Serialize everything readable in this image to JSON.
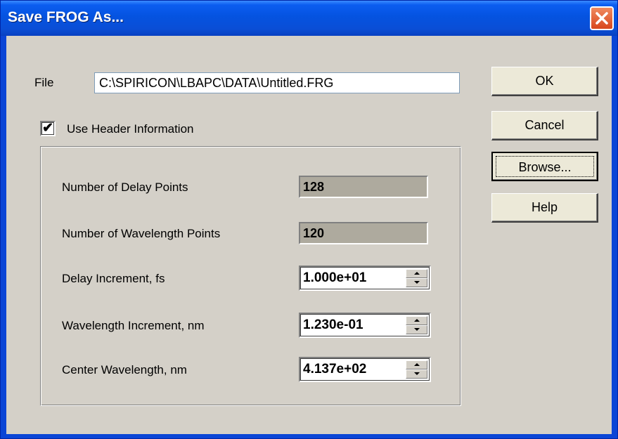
{
  "window": {
    "title": "Save FROG As..."
  },
  "file": {
    "label": "File",
    "value": "C:\\SPIRICON\\LBAPC\\DATA\\Untitled.FRG"
  },
  "header_option": {
    "label": "Use Header Information",
    "checked": true,
    "check_glyph": "✔"
  },
  "fields": {
    "delay_points": {
      "label": "Number of Delay Points",
      "value": "128"
    },
    "wavelength_points": {
      "label": "Number of Wavelength Points",
      "value": "120"
    },
    "delay_increment": {
      "label": "Delay Increment, fs",
      "value": "1.000e+01"
    },
    "wavelength_increment": {
      "label": "Wavelength Increment, nm",
      "value": "1.230e-01"
    },
    "center_wavelength": {
      "label": "Center Wavelength, nm",
      "value": "4.137e+02"
    }
  },
  "buttons": {
    "ok": "OK",
    "cancel": "Cancel",
    "browse": "Browse...",
    "help": "Help"
  },
  "colors": {
    "title_bar": "#0553e0",
    "dialog_face": "#d4d0c8",
    "readonly_field": "#aeaa9e",
    "close_button": "#e05a2c"
  },
  "icons": {
    "close": "close-icon",
    "spin_up": "spin-up-arrow-icon",
    "spin_down": "spin-down-arrow-icon",
    "check": "checkmark-icon"
  }
}
